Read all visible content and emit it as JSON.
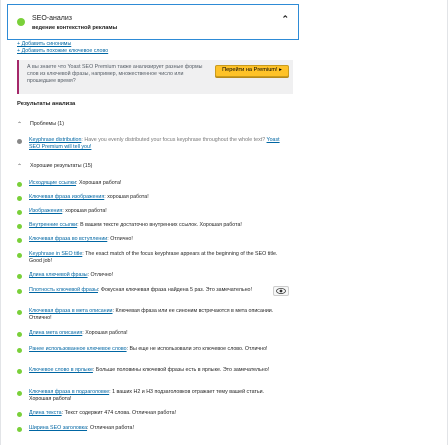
{
  "header": {
    "title": "SEO-анализ",
    "subtitle": "ведение контекстной рекламы",
    "collapse_glyph": "⌃"
  },
  "links": [
    "+ Добавить синонимы",
    "+ Добавить похожие ключевое слово"
  ],
  "promo": {
    "text": "А вы знаете что Yoast SEO Premium также анализирует разные формы слов из ключевой фразы, например, множественное число или прошедшее время?",
    "button_label": "Перейти на Premium! ▸"
  },
  "results_title": "Результаты анализа",
  "problems": {
    "label": "Проблемы (1)",
    "items": [
      {
        "link": "Keyphrase distribution",
        "text": ": Have you evenly distributed your focus keyphrase throughout the whole text? ",
        "link2": "Yoast SEO Premium will tell you!"
      }
    ]
  },
  "good": {
    "label": "Хорошие результаты (15)",
    "items": [
      {
        "link": "Исходящие ссылки",
        "text": ": Хорошая работа!"
      },
      {
        "link": "Ключевая фраза изображения",
        "text": ": хорошая работа!"
      },
      {
        "link": "Изображения",
        "text": ": хорошая работа!"
      },
      {
        "link": "Внутренние ссылки",
        "text": ": В вашем тексте достаточно внутренних ссылок. Хорошая работа!"
      },
      {
        "link": "Ключевая фраза во вступлении",
        "text": ": Отлично!"
      },
      {
        "link": "Keyphrase in SEO title",
        "text": ": The exact match of the focus keyphrase appears at the beginning of the SEO title. Good job!"
      },
      {
        "link": "Длина ключевой фразы",
        "text": ": Отлично!"
      },
      {
        "link": "Плотность ключевой фразы",
        "text": ": Фокусная ключевая фраза найдена 5 раз. Это замечательно!"
      },
      {
        "link": "Ключевая фраза в мета описании",
        "text": ": Ключевая фраза или ее синоним встречаются в мета описании. Отлично!"
      },
      {
        "link": "Длина мета описания",
        "text": ": Хорошая работа!"
      },
      {
        "link": "Ранее использованное ключевое слово",
        "text": ": Вы еще не использовали это ключевое слово. Отлично!"
      },
      {
        "link": "Ключевое слово в ярлыке",
        "text": ": Больше половины ключевой фразы есть в ярлыке. Это замечательно!"
      },
      {
        "link": "Ключевая фраза в подзаголовке",
        "text": ": 1 ваших H2 и H3 подзаголовков отражает тему вашей статьи. Хорошая работа!"
      },
      {
        "link": "Длина текста",
        "text": ": Текст содержит 474 слова. Отличная работа!"
      },
      {
        "link": "Ширина SEO заголовка",
        "text": ": Отличная работа!"
      }
    ]
  },
  "icons": {
    "eye": "eye-icon",
    "status_good_color": "#7ad03a",
    "status_neutral_color": "#888888",
    "accent_link_color": "#0066a3",
    "promo_button_color": "#fec228"
  }
}
